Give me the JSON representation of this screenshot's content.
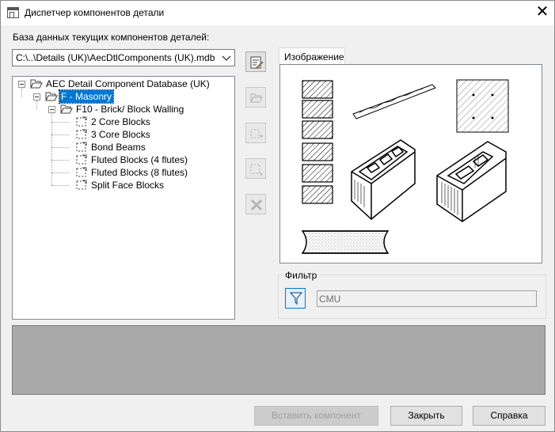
{
  "window": {
    "title": "Диспетчер компонентов детали"
  },
  "database": {
    "label": "База данных текущих компонентов деталей:",
    "path": "C:\\..\\Details (UK)\\AecDtlComponents (UK).mdb"
  },
  "tree": {
    "root": "AEC Detail Component Database (UK)",
    "masonry": "F - Masonry",
    "walling": "F10 - Brick/ Block Walling",
    "leaves": [
      "2 Core Blocks",
      "3 Core Blocks",
      "Bond Beams",
      "Fluted Blocks (4 flutes)",
      "Fluted Blocks (8 flutes)",
      "Split Face Blocks"
    ]
  },
  "tabs": {
    "image": "Изображение"
  },
  "filter": {
    "legend": "Фильтр",
    "value": "CMU"
  },
  "buttons": {
    "insert": "Вставить компонент",
    "close": "Закрыть",
    "help": "Справка"
  },
  "icons": [
    "window-icon",
    "close-icon",
    "edit-database-icon",
    "open-folder-icon",
    "add-group-icon",
    "add-component-icon",
    "delete-icon",
    "filter-icon",
    "chevron-down-icon"
  ]
}
